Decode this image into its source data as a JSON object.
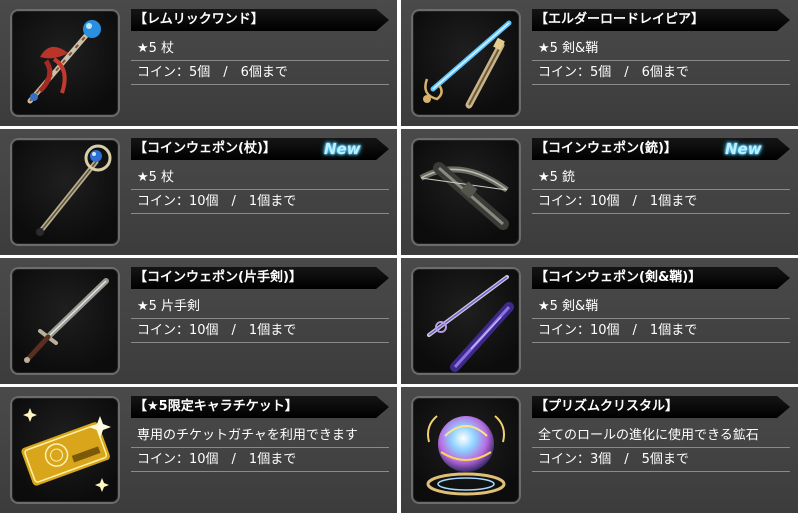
{
  "items": [
    {
      "title": "【レムリックワンド】",
      "new_label": "",
      "subtitle": "★5 杖",
      "coins": "コイン：5個　/　6個まで",
      "icon": "lemric-wand-icon"
    },
    {
      "title": "【エルダーロードレイピア】",
      "new_label": "",
      "subtitle": "★5 剣&鞘",
      "coins": "コイン：5個　/　6個まで",
      "icon": "elder-lord-rapier-icon"
    },
    {
      "title": "【コインウェポン(杖)】",
      "new_label": "New",
      "subtitle": "★5 杖",
      "coins": "コイン：10個　/　1個まで",
      "icon": "coin-weapon-staff-icon"
    },
    {
      "title": "【コインウェポン(銃)】",
      "new_label": "New",
      "subtitle": "★5 銃",
      "coins": "コイン：10個　/　1個まで",
      "icon": "coin-weapon-crossbow-icon"
    },
    {
      "title": "【コインウェポン(片手剣)】",
      "new_label": "",
      "subtitle": "★5 片手剣",
      "coins": "コイン：10個　/　1個まで",
      "icon": "coin-weapon-sword-icon"
    },
    {
      "title": "【コインウェポン(剣&鞘)】",
      "new_label": "",
      "subtitle": "★5 剣&鞘",
      "coins": "コイン：10個　/　1個まで",
      "icon": "coin-weapon-sword-sheath-icon"
    },
    {
      "title": "【★5限定キャラチケット】",
      "new_label": "",
      "subtitle": "専用のチケットガチャを利用できます",
      "coins": "コイン：10個　/　1個まで",
      "icon": "gold-ticket-icon"
    },
    {
      "title": "【プリズムクリスタル】",
      "new_label": "",
      "subtitle": "全てのロールの進化に使用できる鉱石",
      "coins": "コイン：3個　/　5個まで",
      "icon": "prism-crystal-icon"
    }
  ],
  "colors": {
    "card_bg": "#434343",
    "title_bar": "#0a0a0a",
    "text": "#ffffff",
    "new_badge": "#38c6ff",
    "divider": "#8a8a8a"
  }
}
